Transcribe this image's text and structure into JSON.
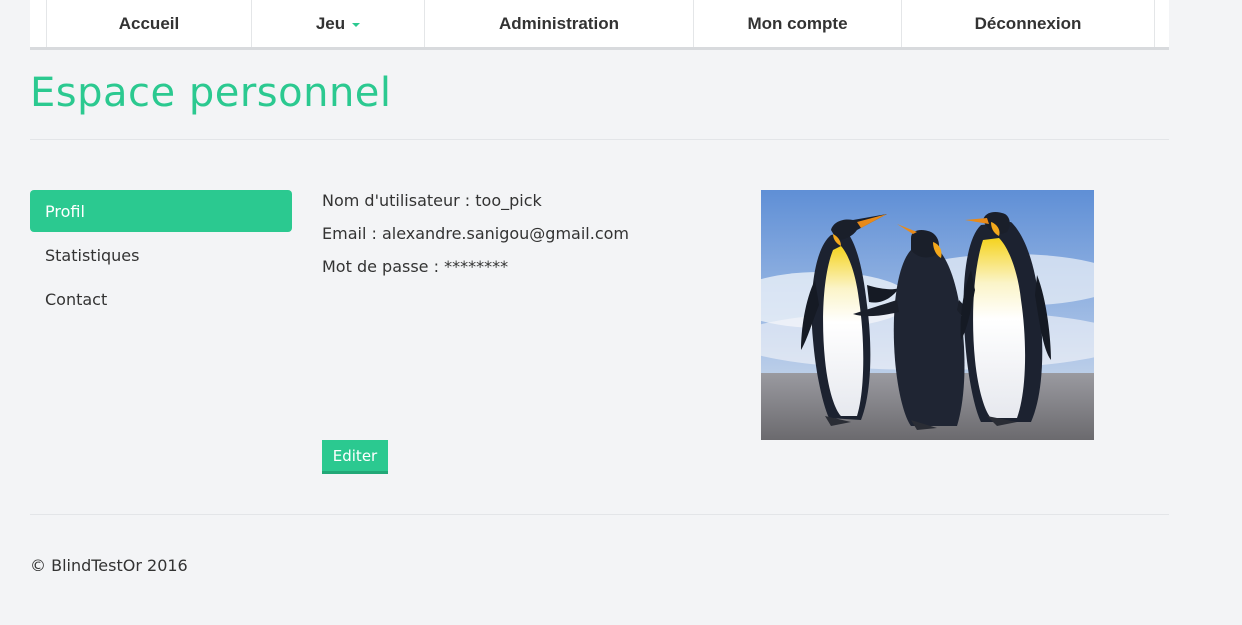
{
  "nav": {
    "items": [
      {
        "label": "Accueil"
      },
      {
        "label": "Jeu"
      },
      {
        "label": "Administration"
      },
      {
        "label": "Mon compte"
      },
      {
        "label": "Déconnexion"
      }
    ]
  },
  "page": {
    "title": "Espace personnel"
  },
  "sidebar": {
    "items": [
      {
        "label": "Profil",
        "active": true
      },
      {
        "label": "Statistiques",
        "active": false
      },
      {
        "label": "Contact",
        "active": false
      }
    ]
  },
  "profile": {
    "username_line": "Nom d'utilisateur : too_pick",
    "email_line": "Email : alexandre.sanigou@gmail.com",
    "password_line": "Mot de passe : ********",
    "edit_label": "Editer",
    "avatar_icon": "penguins-photo"
  },
  "footer": {
    "copyright": "© BlindTestOr 2016"
  },
  "colors": {
    "accent": "#2bc990",
    "background": "#f3f4f6"
  }
}
